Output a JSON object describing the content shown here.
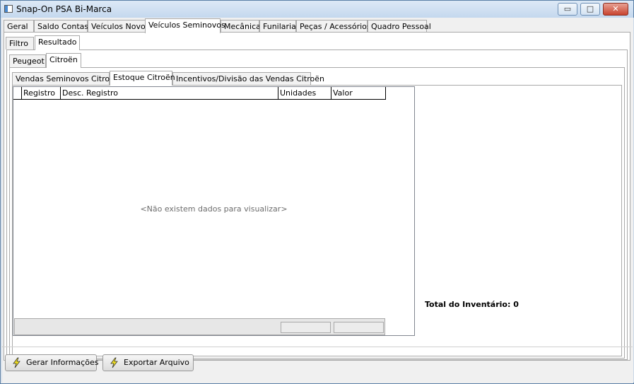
{
  "window": {
    "title": "Snap-On PSA Bi-Marca",
    "min_glyph": "▭",
    "max_glyph": "□",
    "close_glyph": "✕"
  },
  "main_tabs": [
    "Geral",
    "Saldo Contas",
    "Veículos Novos",
    "Veículos Seminovos",
    "Mecânica",
    "Funilaria",
    "Peças / Acessórios",
    "Quadro Pessoal"
  ],
  "sub_tabs": [
    "Filtro",
    "Resultado"
  ],
  "brand_tabs": [
    "Peugeot",
    "Citroën"
  ],
  "report_tabs": [
    "Vendas Seminovos Citroën",
    "Estoque Citroën",
    "Incentivos/Divisão das Vendas Citroën"
  ],
  "grid": {
    "columns": [
      "Registro",
      "Desc. Registro",
      "Unidades",
      "Valor"
    ],
    "empty_message": "<Não existem dados para visualizar>"
  },
  "total_label": "Total do Inventário: 0",
  "buttons": {
    "generate": "Gerar Informações",
    "export": "Exportar Arquivo"
  },
  "colors": {
    "accent": "#c8442f",
    "icon_yellow": "#f5e31f"
  }
}
